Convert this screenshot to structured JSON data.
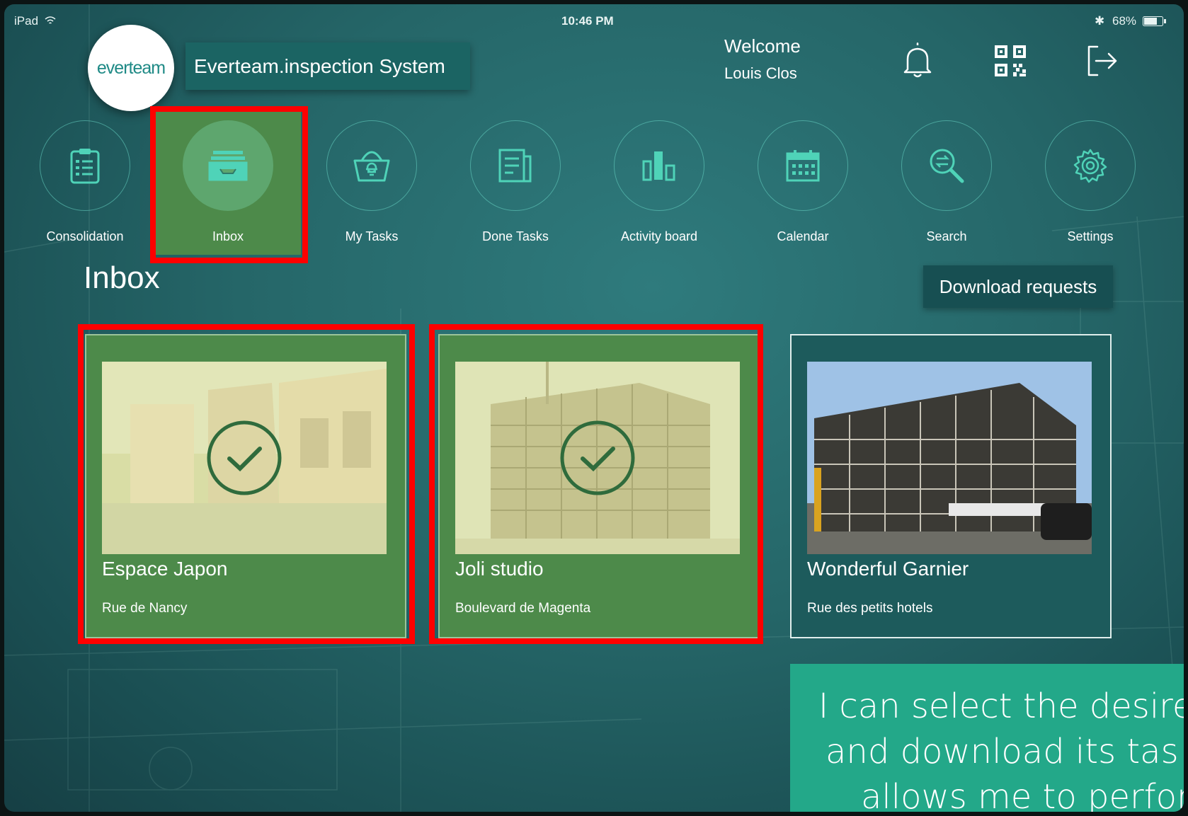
{
  "status_bar": {
    "device": "iPad",
    "time": "10:46 PM",
    "battery": "68%"
  },
  "header": {
    "logo_text": "everteam",
    "app_title": "Everteam.inspection System",
    "welcome": "Welcome",
    "user_name": "Louis Clos"
  },
  "nav": {
    "items": [
      {
        "label": "Consolidation",
        "icon": "clipboard-icon"
      },
      {
        "label": "Inbox",
        "icon": "inbox-tray-icon",
        "active": true
      },
      {
        "label": "My Tasks",
        "icon": "basket-icon"
      },
      {
        "label": "Done Tasks",
        "icon": "document-icon"
      },
      {
        "label": "Activity board",
        "icon": "bar-chart-icon"
      },
      {
        "label": "Calendar",
        "icon": "calendar-icon"
      },
      {
        "label": "Search",
        "icon": "search-icon"
      },
      {
        "label": "Settings",
        "icon": "gear-icon"
      }
    ]
  },
  "main": {
    "title": "Inbox",
    "download_label": "Download requests",
    "cards": [
      {
        "name": "Espace Japon",
        "address": "Rue de Nancy",
        "selected": true
      },
      {
        "name": "Joli studio",
        "address": "Boulevard de Magenta",
        "selected": true
      },
      {
        "name": "Wonderful Garnier",
        "address": "Rue des petits hotels",
        "selected": false
      }
    ]
  },
  "tooltip": {
    "line1": "I can select the desired",
    "line2": "and download its task li",
    "line3": "allows me to perform"
  },
  "colors": {
    "accent": "#23a889",
    "highlight": "#ff0000",
    "selected_fill": "#4d8a4a",
    "background": "#256668"
  }
}
